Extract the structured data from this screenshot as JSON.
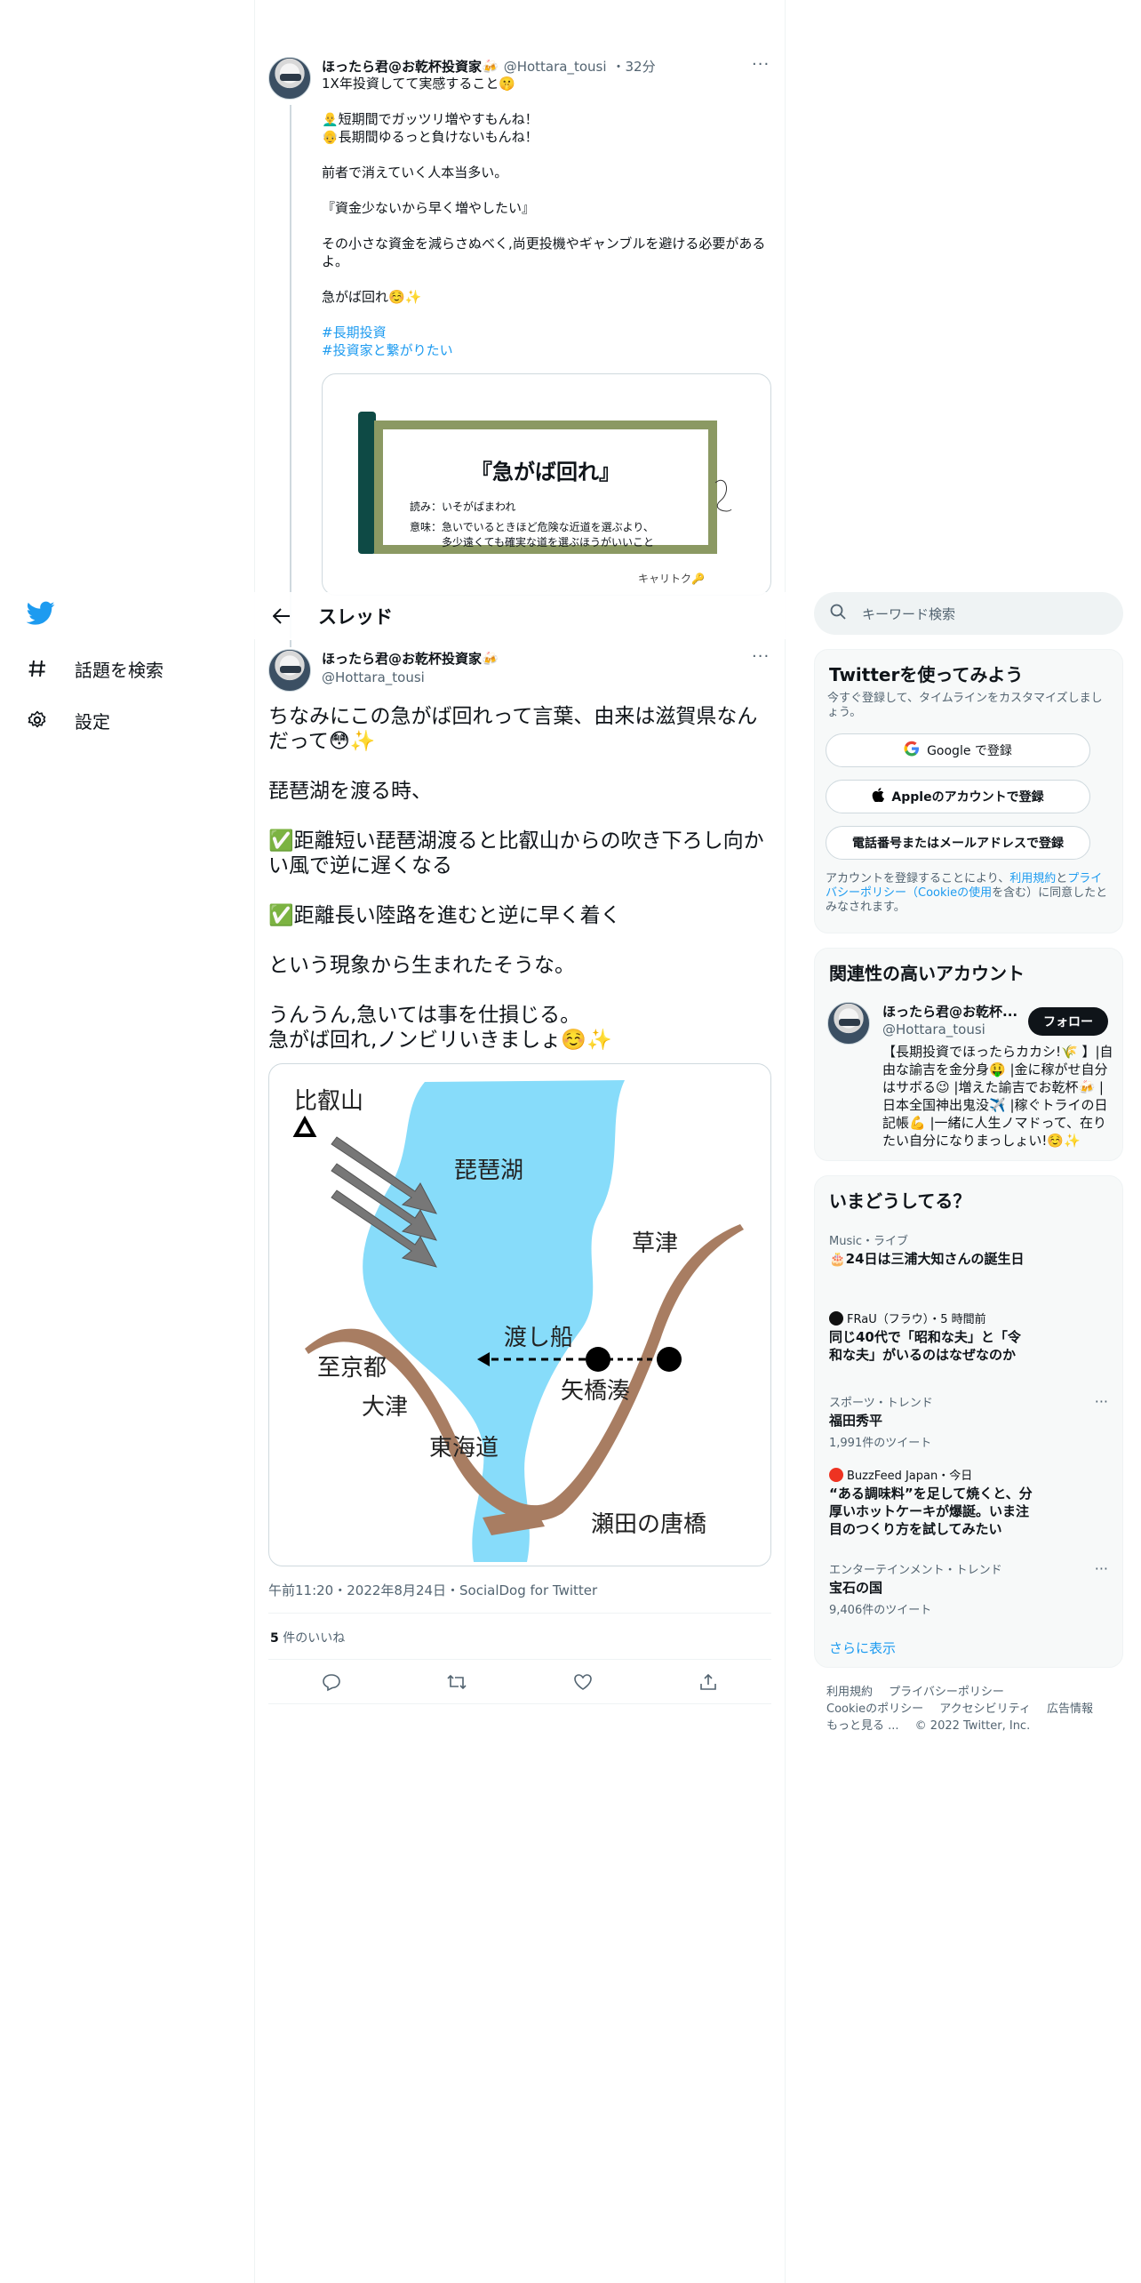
{
  "nav": {
    "items": [
      {
        "label": "話題を検索",
        "icon": "hashtag-icon"
      },
      {
        "label": "設定",
        "icon": "gear-icon"
      }
    ]
  },
  "header": {
    "title": "スレッド"
  },
  "parent_tweet": {
    "name": "ほったら君@お乾杯投資家🍻",
    "handle": "@Hottara_tousi",
    "time": "・32分",
    "text": "1X年投資してて実感すること🤫\n\n👨‍🦲短期間でガッツリ増やすもんね！\n👴長期間ゆるっと負けないもんね！\n\n前者で消えていく人本当多い。\n\n『資金少ないから早く増やしたい』\n\nその小さな資金を減らさぬべく,尚更投機やギャンブルを避ける必要があるよ。\n\n急がば回れ☺️✨",
    "hashtags": [
      "#長期投資",
      "#投資家と繋がりたい"
    ],
    "card": {
      "title": "『急がば回れ』",
      "yomi": "読み：いそがばまわれ",
      "imi": "意味：急いでいるときほど危険な近道を選ぶより、\n　　　多少遠くても確実な道を選ぶほうがいいこと",
      "brand": "キャリトク🔑"
    }
  },
  "main_tweet": {
    "name": "ほったら君@お乾杯投資家🍻",
    "handle": "@Hottara_tousi",
    "text": "ちなみにこの急がば回れって言葉、由来は滋賀県なんだって😳✨\n\n琵琶湖を渡る時、\n\n✅距離短い琵琶湖渡ると比叡山からの吹き下ろし向かい風で逆に遅くなる\n\n✅距離長い陸路を進むと逆に早く着く\n\nという現象から生まれたそうな。\n\nうんうん,急いては事を仕損じる。\n急がば回れ,ノンビリいきましょ☺️✨",
    "map_labels": {
      "mountain": "比叡山",
      "lake": "琵琶湖",
      "kusatsu": "草津",
      "ferry": "渡し船",
      "yabase": "矢橋湊",
      "shikyoto": "至京都",
      "otsu": "大津",
      "tokaido": "東海道",
      "karahashi": "瀬田の唐橋"
    },
    "meta": "午前11:20・2022年8月24日・SocialDog for Twitter",
    "likes_count": "5",
    "likes_label": " 件のいいね"
  },
  "search": {
    "placeholder": "キーワード検索"
  },
  "signup": {
    "title": "Twitterを使ってみよう",
    "subtitle": "今すぐ登録して、タイムラインをカスタマイズしましょう。",
    "google": "Google で登録",
    "apple": "Appleのアカウントで登録",
    "phone": "電話番号またはメールアドレスで登録",
    "terms_pre": "アカウントを登録することにより、",
    "terms_link1": "利用規約",
    "terms_mid": "と",
    "terms_link2": "プライバシーポリシー（Cookieの使用",
    "terms_post": "を含む）に同意したとみなされます。"
  },
  "related": {
    "title": "関連性の高いアカウント",
    "name": "ほったら君@お乾杯...",
    "handle": "@Hottara_tousi",
    "follow": "フォロー",
    "bio": "【長期投資でほったらカカシ!🌾 】|自由な諭吉を金分身🤑 |金に稼がせ自分はサボる😉 |増えた諭吉でお乾杯🍻 |日本全国神出鬼没✈️ |稼ぐトライの日記帳💪 |一緒に人生ノマドって、在りたい自分になりまっしょい!☺️✨"
  },
  "trends": {
    "title": "いまどうしてる？",
    "items": [
      {
        "ctx": "Music・ライブ",
        "title": "🎂24日は三浦大知さんの誕生日",
        "count": ""
      },
      {
        "ctx": "FRaU（フラウ）・5 時間前",
        "title": "同じ40代で「昭和な夫」と「令和な夫」がいるのはなぜなのか",
        "count": ""
      },
      {
        "ctx": "スポーツ・トレンド",
        "title": "福田秀平",
        "count": "1,991件のツイート"
      },
      {
        "ctx": "BuzzFeed Japan・今日",
        "title": "“ある調味料”を足して焼くと、分厚いホットケーキが爆誕。いま注目のつくり方を試してみたい",
        "count": ""
      },
      {
        "ctx": "エンターテインメント・トレンド",
        "title": "宝石の国",
        "count": "9,406件のツイート"
      }
    ],
    "show_more": "さらに表示"
  },
  "footer": {
    "links": [
      "利用規約",
      "プライバシーポリシー",
      "Cookieのポリシー",
      "アクセシビリティ",
      "広告情報",
      "もっと見る ...",
      "© 2022 Twitter, Inc."
    ]
  },
  "colors": {
    "accent": "#1d9bf0",
    "text": "#0f1419",
    "muted": "#536471",
    "lake": "#87dcfa",
    "road": "#a87d62"
  }
}
